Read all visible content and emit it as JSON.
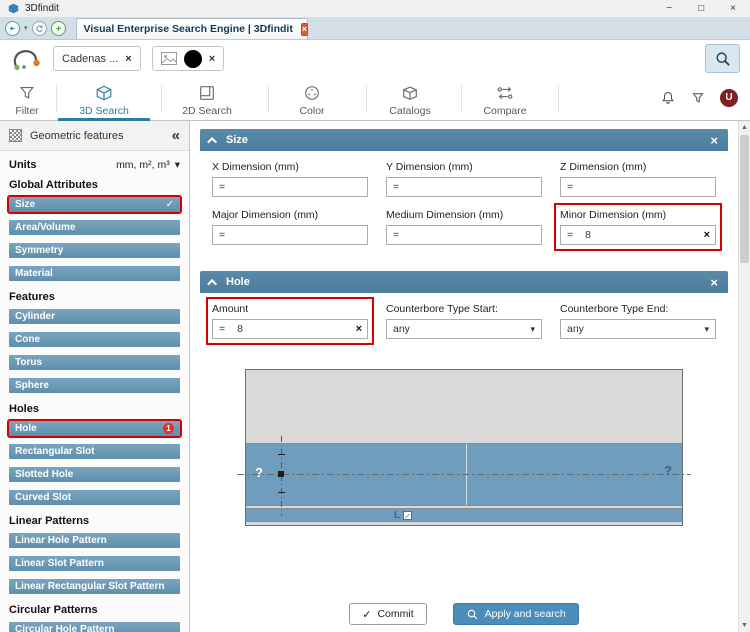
{
  "window": {
    "title": "3Dfindit"
  },
  "icons": {
    "caret_down": "▾",
    "collapse_left": "«",
    "check": "✓",
    "close": "×",
    "minimize": "−",
    "maximize": "□",
    "triangle_up": "▲",
    "triangle_down": "▼"
  },
  "tab": {
    "title": "Visual Enterprise Search Engine | 3Dfindit"
  },
  "search": {
    "term_chip": "Cadenas ..."
  },
  "toolbar": {
    "items": [
      {
        "label": "Filter"
      },
      {
        "label": "3D Search"
      },
      {
        "label": "2D Search"
      },
      {
        "label": "Color"
      },
      {
        "label": "Catalogs"
      },
      {
        "label": "Compare"
      }
    ],
    "user_initial": "U"
  },
  "sidebar": {
    "header": "Geometric features",
    "units_label": "Units",
    "units_value": "mm, m², m³",
    "sections": [
      {
        "heading": "Global Attributes",
        "items": [
          {
            "label": "Size"
          },
          {
            "label": "Area/Volume"
          },
          {
            "label": "Symmetry"
          },
          {
            "label": "Material"
          }
        ]
      },
      {
        "heading": "Features",
        "items": [
          {
            "label": "Cylinder"
          },
          {
            "label": "Cone"
          },
          {
            "label": "Torus"
          },
          {
            "label": "Sphere"
          }
        ]
      },
      {
        "heading": "Holes",
        "items": [
          {
            "label": "Hole",
            "badge": "1"
          },
          {
            "label": "Rectangular Slot"
          },
          {
            "label": "Slotted Hole"
          },
          {
            "label": "Curved Slot"
          }
        ]
      },
      {
        "heading": "Linear Patterns",
        "items": [
          {
            "label": "Linear Hole Pattern"
          },
          {
            "label": "Linear Slot Pattern"
          },
          {
            "label": "Linear Rectangular Slot Pattern"
          }
        ]
      },
      {
        "heading": "Circular Patterns",
        "items": [
          {
            "label": "Circular Hole Pattern"
          }
        ]
      }
    ]
  },
  "size_panel": {
    "title": "Size",
    "fields": [
      {
        "label": "X Dimension (mm)",
        "operator": "=",
        "value": ""
      },
      {
        "label": "Y Dimension (mm)",
        "operator": "=",
        "value": ""
      },
      {
        "label": "Z Dimension (mm)",
        "operator": "=",
        "value": ""
      },
      {
        "label": "Major Dimension (mm)",
        "operator": "=",
        "value": ""
      },
      {
        "label": "Medium Dimension (mm)",
        "operator": "=",
        "value": ""
      },
      {
        "label": "Minor Dimension (mm)",
        "operator": "=",
        "value": "8"
      }
    ]
  },
  "hole_panel": {
    "title": "Hole",
    "amount": {
      "label": "Amount",
      "operator": "=",
      "value": "8"
    },
    "counterbore_start": {
      "label": "Counterbore Type Start:",
      "value": "any"
    },
    "counterbore_end": {
      "label": "Counterbore Type End:",
      "value": "any"
    },
    "drawing": {
      "question_left": "?",
      "question_right": "?",
      "length_label": "L"
    }
  },
  "footer": {
    "commit": "Commit",
    "apply": "Apply and search"
  }
}
